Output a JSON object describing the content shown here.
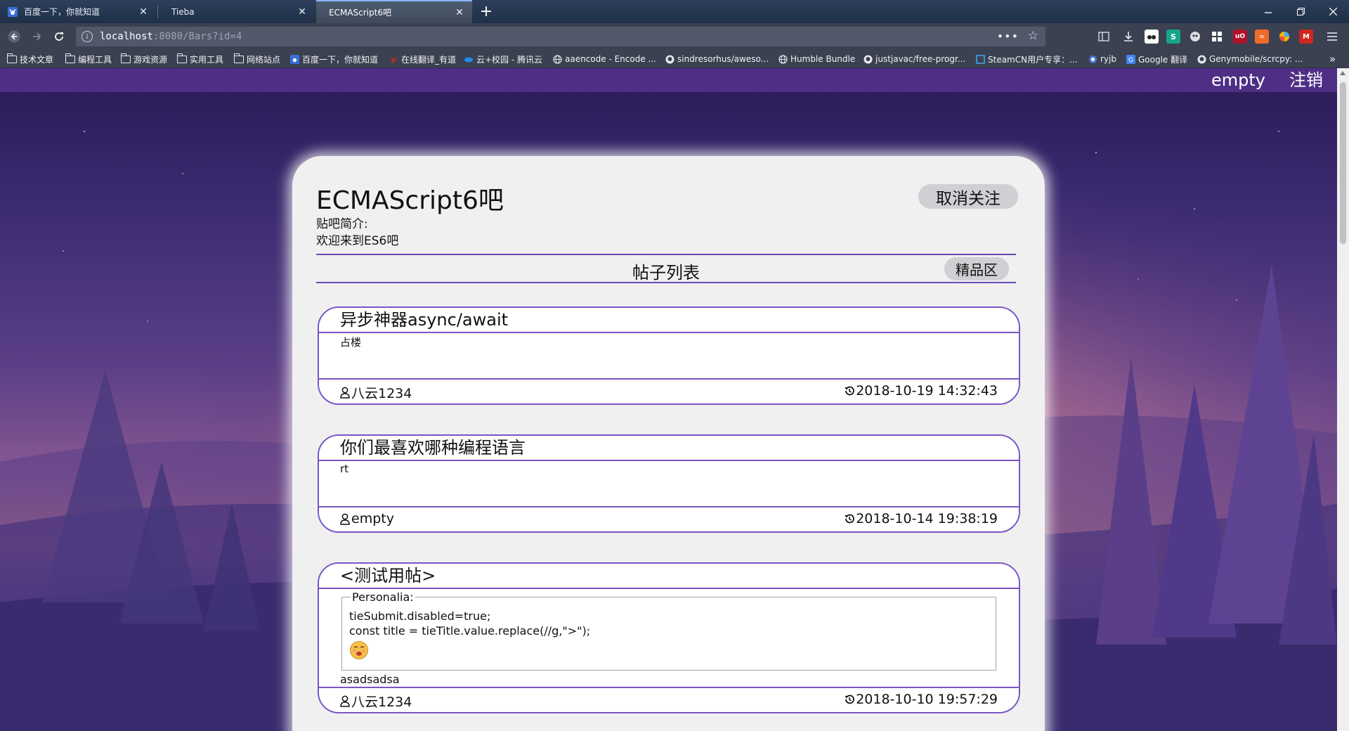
{
  "browser": {
    "tabs": [
      {
        "title": "百度一下，你就知道",
        "active": false
      },
      {
        "title": "Tieba",
        "active": false
      },
      {
        "title": "ECMAScript6吧",
        "active": true
      }
    ],
    "url_host": "localhost",
    "url_rest": ":8080/Bars?id=4",
    "bookmarks": [
      "技术文章",
      "编程工具",
      "游戏资源",
      "实用工具",
      "网络站点",
      "百度一下，你就知道",
      "在线翻译_有道",
      "云+校园 - 腾讯云",
      "aaencode - Encode ...",
      "sindresorhus/aweso...",
      "Humble Bundle",
      "justjavac/free-progr...",
      "SteamCN用户专享：...",
      "ryjb",
      "Google 翻译",
      "Genymobile/scrcpy: ..."
    ]
  },
  "header": {
    "username": "empty",
    "logout_label": "注销"
  },
  "bar": {
    "title": "ECMAScript6吧",
    "follow_label": "取消关注",
    "intro_label": "贴吧简介:",
    "intro_text": "欢迎来到ES6吧"
  },
  "list": {
    "heading": "帖子列表",
    "elite_label": "精品区"
  },
  "posts": [
    {
      "title": "异步神器async/await",
      "body": "占楼",
      "author": "八云1234",
      "time": "2018-10-19 14:32:43"
    },
    {
      "title": "你们最喜欢哪种编程语言",
      "body": "rt",
      "author": "empty",
      "time": "2018-10-14 19:38:19"
    },
    {
      "title": "<测试用帖>",
      "fieldset_legend": "Personalia:",
      "code_lines": [
        "tieSubmit.disabled=true;",
        "const title = tieTitle.value.replace(//g,\">\");"
      ],
      "after_text": "asadsadsa",
      "author": "八云1234",
      "time": "2018-10-10 19:57:29"
    }
  ]
}
